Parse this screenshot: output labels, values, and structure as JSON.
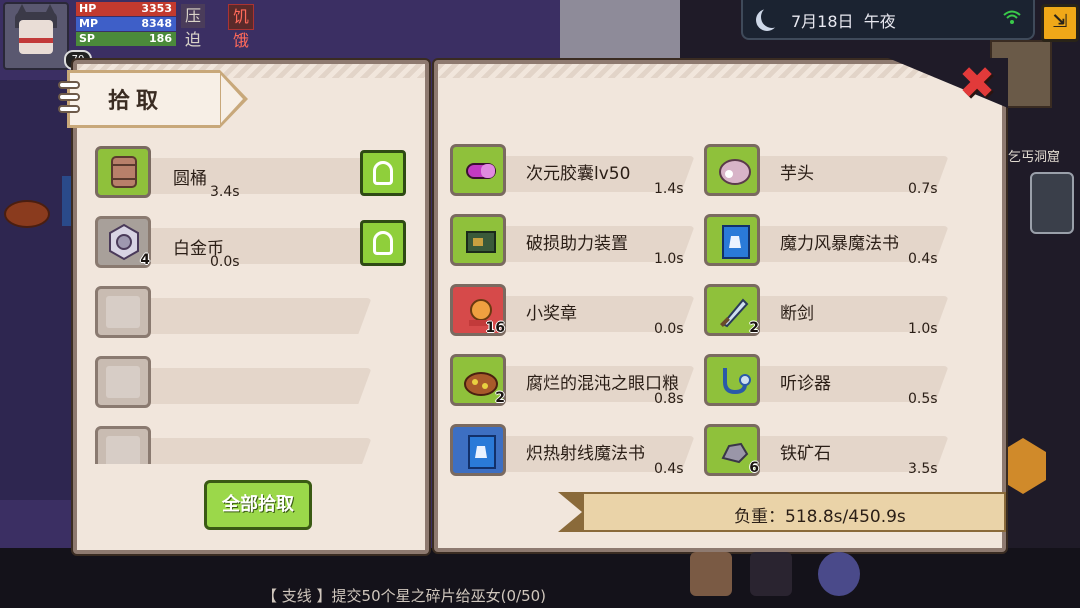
{
  "player": {
    "level": "70",
    "hp_label": "HP",
    "hp_value": "3353",
    "mp_label": "MP",
    "mp_value": "8348",
    "sp_label": "SP",
    "sp_value": "186",
    "status_tags": [
      "压迫",
      "饥饿"
    ]
  },
  "clock": {
    "date": "7月18日",
    "time_of_day": "午夜"
  },
  "left_panel": {
    "title": "拾取",
    "items": [
      {
        "name": "圆桶",
        "time": "3.4s",
        "count": "",
        "icon": "barrel-icon"
      },
      {
        "name": "白金币",
        "time": "0.0s",
        "count": "4",
        "icon": "platinum-coin-icon"
      }
    ],
    "pick_all_label": "全部拾取"
  },
  "right_panel": {
    "items": [
      {
        "name": "次元胶囊lv50",
        "time": "1.4s",
        "count": "",
        "icon": "capsule-icon",
        "box": "green"
      },
      {
        "name": "芋头",
        "time": "0.7s",
        "count": "",
        "icon": "taro-icon",
        "box": "green"
      },
      {
        "name": "破损助力装置",
        "time": "1.0s",
        "count": "",
        "icon": "device-icon",
        "box": "green"
      },
      {
        "name": "魔力风暴魔法书",
        "time": "0.4s",
        "count": "",
        "icon": "magic-book-icon",
        "box": "green"
      },
      {
        "name": "小奖章",
        "time": "0.0s",
        "count": "16",
        "icon": "medal-icon",
        "box": "red"
      },
      {
        "name": "断剑",
        "time": "1.0s",
        "count": "2",
        "icon": "broken-sword-icon",
        "box": "green"
      },
      {
        "name": "腐烂的混沌之眼口粮",
        "time": "0.8s",
        "count": "2",
        "icon": "rotten-ration-icon",
        "box": "green"
      },
      {
        "name": "听诊器",
        "time": "0.5s",
        "count": "",
        "icon": "stethoscope-icon",
        "box": "green"
      },
      {
        "name": "炽热射线魔法书",
        "time": "0.4s",
        "count": "",
        "icon": "magic-book-icon",
        "box": "blue"
      },
      {
        "name": "铁矿石",
        "time": "3.5s",
        "count": "6",
        "icon": "iron-ore-icon",
        "box": "green"
      }
    ],
    "weight_label": "负重：518.8s/450.9s"
  },
  "side": {
    "location_text": "乞丐洞窟"
  },
  "quest": {
    "text": "【 支线 】提交50个星之碎片给巫女(0/50)"
  },
  "colors": {
    "accent_green": "#8fc13b",
    "panel_bg": "#f1e6dc",
    "close_red": "#e23a3a"
  }
}
